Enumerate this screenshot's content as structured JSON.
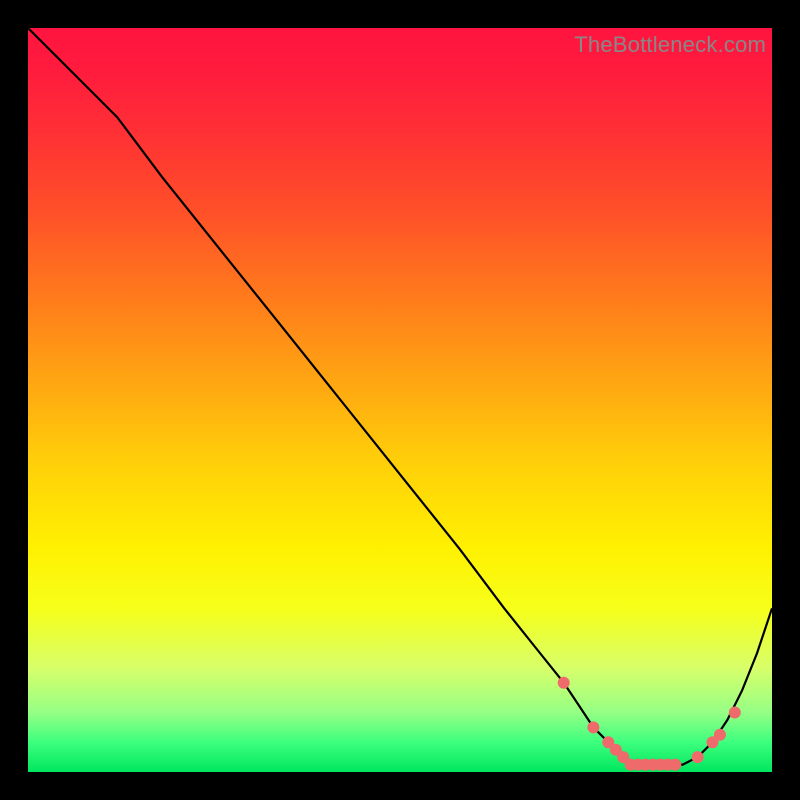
{
  "watermark": "TheBottleneck.com",
  "colors": {
    "curve": "#000000",
    "marker": "#ef6b6b",
    "background_top": "#ff143f",
    "background_bottom": "#00e65e"
  },
  "chart_data": {
    "type": "line",
    "title": "",
    "xlabel": "",
    "ylabel": "",
    "xlim": [
      0,
      100
    ],
    "ylim": [
      0,
      100
    ],
    "grid": false,
    "series": [
      {
        "name": "bottleneck-curve",
        "x": [
          0,
          4,
          8,
          12,
          18,
          26,
          34,
          42,
          50,
          58,
          64,
          68,
          72,
          74,
          76,
          78,
          80,
          82,
          84,
          86,
          88,
          90,
          92,
          94,
          96,
          98,
          100
        ],
        "y": [
          100,
          96,
          92,
          88,
          80,
          70,
          60,
          50,
          40,
          30,
          22,
          17,
          12,
          9,
          6,
          4,
          2,
          1,
          1,
          1,
          1,
          2,
          4,
          7,
          11,
          16,
          22
        ]
      }
    ],
    "markers": {
      "series": "bottleneck-curve",
      "x": [
        72,
        76,
        78,
        79,
        80,
        81,
        82,
        83,
        84,
        85,
        86,
        87,
        90,
        92,
        93,
        95
      ],
      "y": [
        12,
        6,
        4,
        3,
        2,
        1,
        1,
        1,
        1,
        1,
        1,
        1,
        2,
        4,
        5,
        8
      ],
      "shape": "circle",
      "size": 6,
      "color": "#ef6b6b"
    }
  }
}
